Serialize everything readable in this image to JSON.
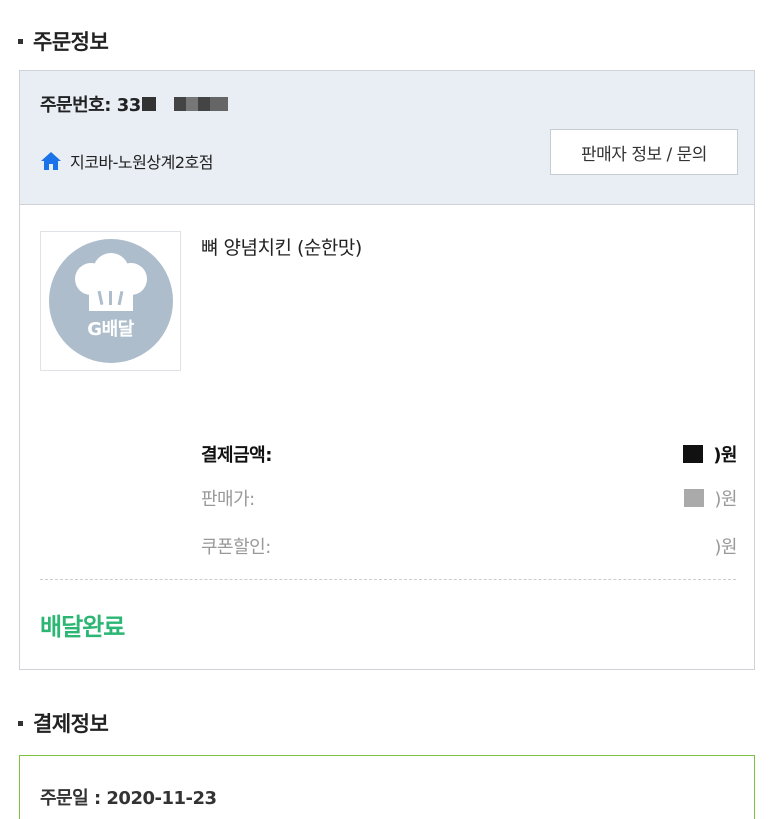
{
  "order_section": {
    "title": "주문정보",
    "order_number_label": "주문번호: 33",
    "store_name": "지코바-노원상계2호점",
    "seller_button_label": "판매자 정보 / 문의",
    "product": {
      "name": "뼈 양념치킨 (순한맛)",
      "thumbnail_text": "G배달"
    },
    "prices": [
      {
        "label": "결제금액:",
        "value": ")원"
      },
      {
        "label": "판매가:",
        "value": ")원"
      },
      {
        "label": "쿠폰할인:",
        "value": ")원"
      }
    ],
    "status": "배달완료"
  },
  "payment_section": {
    "title": "결제정보",
    "order_date": "주문일 : 2020-11-23"
  },
  "colors": {
    "status_green": "#2bb673",
    "header_bg": "#e9eef5",
    "home_icon_blue": "#1a73e8",
    "pay_border": "#7bc143"
  },
  "icons": {
    "store": "home-icon",
    "thumbnail": "chef-hat-icon"
  }
}
